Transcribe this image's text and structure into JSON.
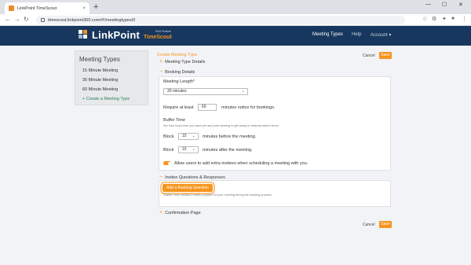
{
  "browser": {
    "tab_title": "LinkPoint TimeScout",
    "tab_close": "×",
    "new_tab": "+",
    "minimize": "—",
    "maximize": "☐",
    "close": "✕",
    "back": "←",
    "forward": "→",
    "reload": "↻",
    "url": "timescout.linkpoint360.com/#!/meetingtypes/0"
  },
  "app": {
    "logo_main": "LinkPoint",
    "logo_sub": "TimeScout",
    "logo_tag": "Pilot Feature",
    "nav": [
      {
        "label": "Meeting Types"
      },
      {
        "label": "Help"
      },
      {
        "label": "Account ▾"
      }
    ]
  },
  "sidebar": {
    "title": "Meeting Types",
    "items": [
      {
        "label": "15 Minute Meeting"
      },
      {
        "label": "30 Minute Meeting"
      },
      {
        "label": "60 Minute Meeting"
      },
      {
        "label": "+ Create a Meeting Type"
      }
    ]
  },
  "main": {
    "breadcrumb": "Create Meeting Type",
    "cancel": "Cancel",
    "save": "Save",
    "sections": {
      "meeting_type_details": {
        "symbol": "+",
        "label": "Meeting Type Details"
      },
      "booking_details": {
        "symbol": "−",
        "label": "Booking Details"
      },
      "invitee_questions": {
        "symbol": "−",
        "label": "Invitee Questions & Responses"
      },
      "confirmation_page": {
        "symbol": "+",
        "label": "Confirmation Page"
      }
    },
    "booking": {
      "meeting_length_label": "Meeting Length*",
      "meeting_length_value": "30 minutes",
      "require_prefix": "Require at least",
      "require_value": "60",
      "require_suffix": "minutes notice for bookings.",
      "buffer_title": "Buffer Time",
      "buffer_desc": "Set how much time you want pre and post meeting to get ready or address action items.",
      "block_label": "Block",
      "block_before_value": "15",
      "block_before_suffix": "minutes before the meeting.",
      "block_after_value": "15",
      "block_after_suffix": "minutes after the meeting.",
      "allow_invitees_label": "Allow users to add extra invitees when scheduling a meeting with you."
    },
    "questions": {
      "add_button": "Add a Booking Question",
      "helper": "Gather more details to better prepare for your meeting during the booking process."
    }
  }
}
